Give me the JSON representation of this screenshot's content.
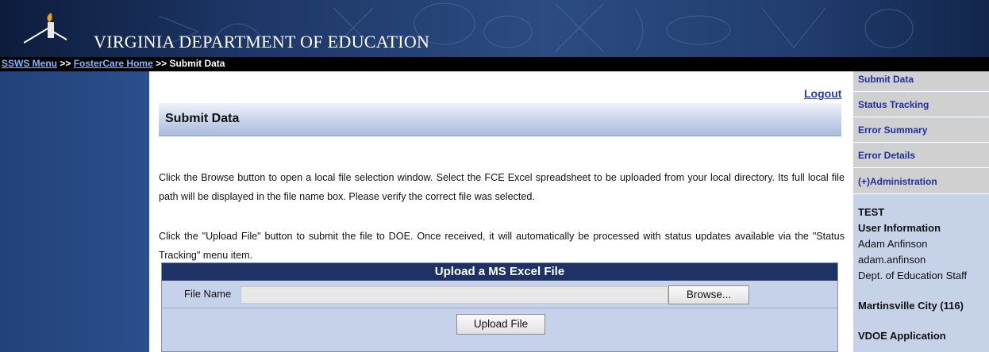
{
  "header": {
    "title": "Virginia Department of Education",
    "title_display": "VIRGINIA DEPARTMENT OF EDUCATION"
  },
  "breadcrumb": {
    "items": [
      "SSWS Menu",
      "FosterCare Home",
      "Submit Data"
    ],
    "separator": ">>"
  },
  "logout_label": "Logout",
  "section": {
    "title": "Submit Data"
  },
  "instructions": {
    "para1": "Click the Browse button to open a local file selection window. Select the FCE Excel spreadsheet to be uploaded from your local directory. Its full local file path will be displayed in the file name box. Please verify the correct file was selected.",
    "para2": "Click the \"Upload File\" button to submit the file to DOE. Once received, it will automatically be processed with status updates available via the \"Status Tracking\" menu item."
  },
  "upload": {
    "title": "Upload a MS Excel File",
    "file_label": "File Name",
    "file_value": "",
    "browse_label": "Browse...",
    "upload_label": "Upload File"
  },
  "sidebar": {
    "items": [
      {
        "label": "Submit Data"
      },
      {
        "label": "Status Tracking"
      },
      {
        "label": "Error Summary"
      },
      {
        "label": "Error Details"
      },
      {
        "label": "(+)Administration"
      }
    ]
  },
  "user": {
    "env": "TEST",
    "heading": "User Information",
    "name": "Adam Anfinson",
    "username": "adam.anfinson",
    "role": "Dept. of Education Staff",
    "division": "Martinsville City (116)",
    "app_label": "VDOE Application"
  },
  "colors": {
    "banner": "#2c4b80",
    "link": "#1f3eb5",
    "nav_text": "#1f2f9e",
    "upload_title_bg": "#1f3266"
  }
}
